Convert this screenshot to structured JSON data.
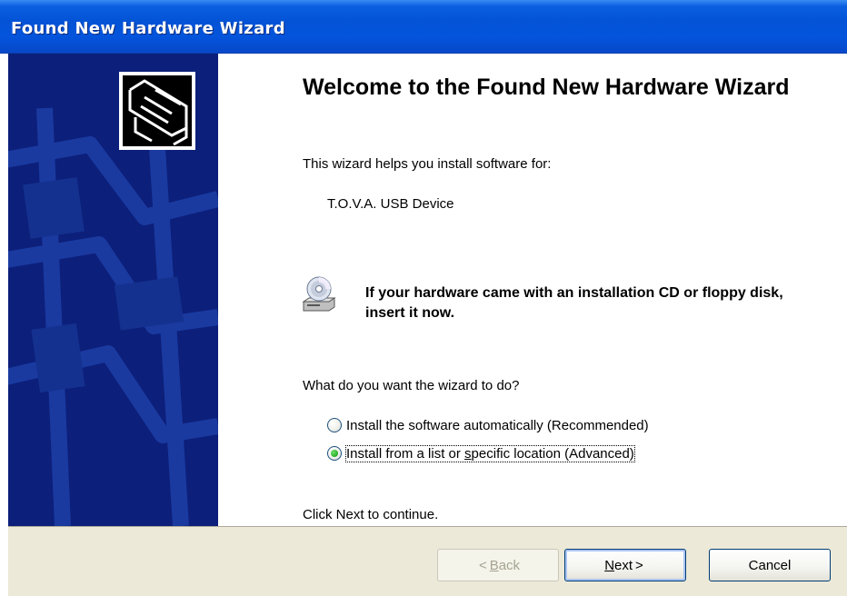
{
  "window": {
    "title": "Found New Hardware Wizard"
  },
  "main": {
    "heading": "Welcome to the Found New Hardware Wizard",
    "intro": "This wizard helps you install software for:",
    "device_name": "T.O.V.A. USB Device",
    "cd_notice": "If your hardware came with an installation CD or floppy disk, insert it now.",
    "question": "What do you want the wizard to do?",
    "options": [
      {
        "label": "Install the software automatically (Recommended)",
        "selected": false
      },
      {
        "label_before": "Install from a list or ",
        "label_underlined": "s",
        "label_after": "pecific location (Advanced)",
        "selected": true
      }
    ],
    "footer_text": "Click Next to continue."
  },
  "buttons": {
    "back": {
      "glyph": "<",
      "mnemonic": "B",
      "rest": "ack",
      "enabled": false
    },
    "next": {
      "mnemonic": "N",
      "rest": "ext",
      "glyph": ">",
      "enabled": true
    },
    "cancel": {
      "label": "Cancel",
      "enabled": true
    }
  },
  "icons": {
    "banner": "hardware-card-icon",
    "cd": "cd-drive-icon"
  },
  "colors": {
    "titlebar": "#0453d6",
    "banner": "#0c1f7a",
    "dialog_bg": "#ece9d8"
  }
}
